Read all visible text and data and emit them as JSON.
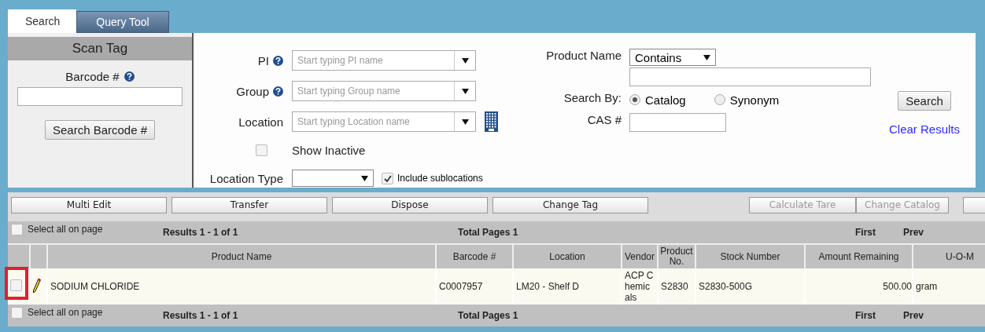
{
  "tabs": [
    {
      "label": "Search",
      "selected": true
    },
    {
      "label": "Query Tool",
      "selected": false
    }
  ],
  "scan_tag": {
    "title": "Scan Tag",
    "barcode_label": "Barcode #",
    "search_button": "Search Barcode #"
  },
  "filters": {
    "pi": {
      "label": "PI",
      "placeholder": "Start typing PI name"
    },
    "group": {
      "label": "Group",
      "placeholder": "Start typing Group name"
    },
    "location": {
      "label": "Location",
      "placeholder": "Start typing Location name"
    },
    "show_inactive": {
      "label": "Show Inactive",
      "checked": false
    },
    "location_type": {
      "label": "Location Type"
    },
    "include_sublocations": {
      "label": "Include sublocations",
      "checked": true
    }
  },
  "product_search": {
    "label": "Product Name",
    "mode": "Contains",
    "search_by_label": "Search By:",
    "search_by": [
      {
        "label": "Catalog",
        "selected": true
      },
      {
        "label": "Synonym",
        "selected": false
      }
    ],
    "cas_label": "CAS #",
    "search_button": "Search",
    "clear_link": "Clear Results"
  },
  "toolbar": [
    {
      "label": "Multi Edit",
      "disabled": false
    },
    {
      "label": "Transfer",
      "disabled": false
    },
    {
      "label": "Dispose",
      "disabled": false
    },
    {
      "label": "Change Tag",
      "disabled": false
    },
    {
      "label": "Calculate Tare",
      "disabled": true
    },
    {
      "label": "Change Catalog",
      "disabled": true
    }
  ],
  "pager_top": {
    "select_all": "Select all on page",
    "select_all_checked": false,
    "results": "Results 1 - 1 of 1",
    "total_pages": "Total Pages 1",
    "first": "First",
    "prev": "Prev"
  },
  "table": {
    "columns": [
      "Product Name",
      "Barcode #",
      "Location",
      "Vendor",
      "Product No.",
      "Stock Number",
      "Amount Remaining",
      "U-O-M"
    ],
    "rows": [
      {
        "checked": false,
        "highlighted": true,
        "cells": [
          "SODIUM CHLORIDE",
          "C0007957",
          "LM20 - Shelf D",
          "ACP Chemicals",
          "S2830",
          "S2830-500G",
          "500.00",
          "gram"
        ]
      }
    ]
  },
  "pager_bottom": {
    "select_all": "Select all on page",
    "select_all_checked": false,
    "results": "Results 1 - 1 of 1",
    "total_pages": "Total Pages 1",
    "first": "First",
    "prev": "Prev"
  }
}
